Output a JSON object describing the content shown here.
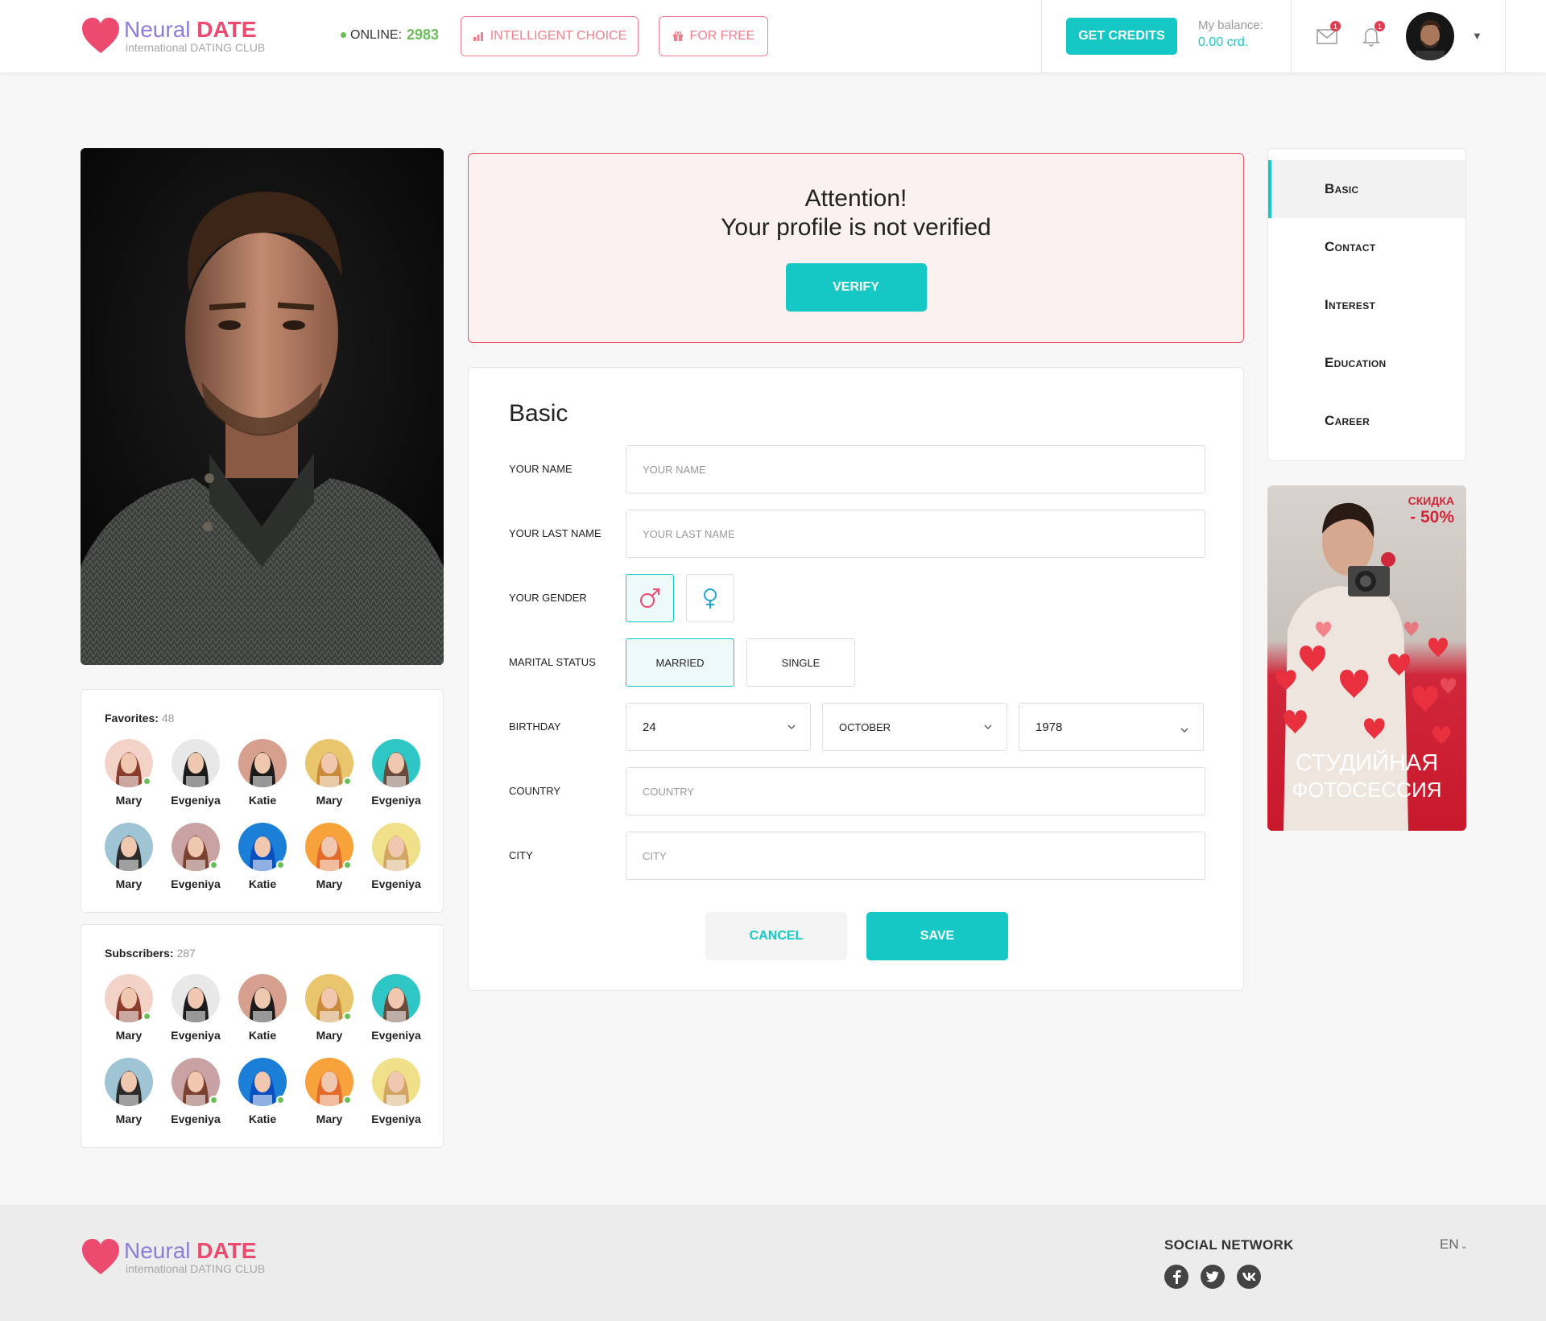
{
  "brand": {
    "name_part1": "Neural",
    "name_part2": "DATE",
    "tagline": "international DATING CLUB"
  },
  "header": {
    "online_label": "ONLINE:",
    "online_count": "2983",
    "intelligent_choice": "INTELLIGENT CHOICE",
    "for_free": "FOR FREE",
    "get_credits": "GET CREDITS",
    "balance_label": "My balance:",
    "balance_value": "0.00 crd.",
    "mail_badge": "1",
    "notif_badge": "1"
  },
  "favorites": {
    "title": "Favorites:",
    "count": "48",
    "people": [
      {
        "name": "Mary",
        "online": true
      },
      {
        "name": "Evgeniya",
        "online": false
      },
      {
        "name": "Katie",
        "online": false
      },
      {
        "name": "Mary",
        "online": true
      },
      {
        "name": "Evgeniya",
        "online": false
      },
      {
        "name": "Mary",
        "online": false
      },
      {
        "name": "Evgeniya",
        "online": true
      },
      {
        "name": "Katie",
        "online": true
      },
      {
        "name": "Mary",
        "online": true
      },
      {
        "name": "Evgeniya",
        "online": false
      }
    ]
  },
  "subscribers": {
    "title": "Subscribers:",
    "count": "287",
    "people": [
      {
        "name": "Mary",
        "online": true
      },
      {
        "name": "Evgeniya",
        "online": false
      },
      {
        "name": "Katie",
        "online": false
      },
      {
        "name": "Mary",
        "online": true
      },
      {
        "name": "Evgeniya",
        "online": false
      },
      {
        "name": "Mary",
        "online": false
      },
      {
        "name": "Evgeniya",
        "online": true
      },
      {
        "name": "Katie",
        "online": true
      },
      {
        "name": "Mary",
        "online": true
      },
      {
        "name": "Evgeniya",
        "online": false
      }
    ]
  },
  "attention": {
    "line1": "Attention!",
    "line2": "Your profile is not verified",
    "button": "VERIFY"
  },
  "form": {
    "title": "Basic",
    "name_label": "YOUR NAME",
    "name_placeholder": "YOUR NAME",
    "lastname_label": "YOUR LAST NAME",
    "lastname_placeholder": "YOUR LAST NAME",
    "gender_label": "YOUR GENDER",
    "gender_selected": "male",
    "marital_label": "MARITAL STATUS",
    "marital_married": "MARRIED",
    "marital_single": "SINGLE",
    "marital_selected": "MARRIED",
    "birthday_label": "BIRTHDAY",
    "birthday_day": "24",
    "birthday_month": "OCTOBER",
    "birthday_year": "1978",
    "country_label": "COUNTRY",
    "country_placeholder": "COUNTRY",
    "city_label": "CITY",
    "city_placeholder": "CITY",
    "cancel": "CANCEL",
    "save": "SAVE"
  },
  "sidenav": {
    "items": [
      "Basic",
      "Contact",
      "Interest",
      "Education",
      "Career"
    ],
    "active": "Basic"
  },
  "ad": {
    "discount_line1": "СКИДКА",
    "discount_line2": "- 50%",
    "title_line1": "СТУДИЙНАЯ",
    "title_line2": "ФОТОСЕССИЯ"
  },
  "footer": {
    "social_title": "SOCIAL NETWORK",
    "lang": "EN"
  },
  "colors": {
    "accent": "#15c8c5",
    "brand_pink": "#ec4a6f",
    "brand_purple": "#8a7ed8",
    "alert_border": "#e7545f"
  }
}
